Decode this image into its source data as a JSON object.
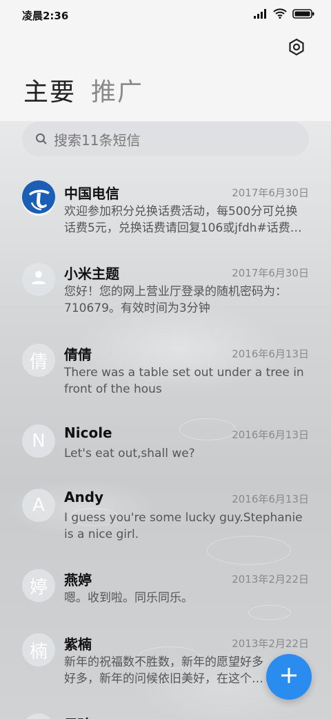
{
  "status_bar": {
    "time": "凌晨2:36"
  },
  "tabs": [
    {
      "label": "主要",
      "active": true
    },
    {
      "label": "推广",
      "active": false
    }
  ],
  "search": {
    "placeholder": "搜索11条短信"
  },
  "conversations": [
    {
      "name": "中国电信",
      "date": "2017年6月30日",
      "preview": "欢迎参加积分兑换话费活动，每500分可兑换话费5元，兑换话费请回复106或jfdh#话费…",
      "avatar_type": "logo",
      "avatar_text": ""
    },
    {
      "name": "小米主题",
      "date": "2017年6月30日",
      "preview": "您好！您的网上营业厅登录的随机密码为：710679。有效时间为3分钟",
      "avatar_type": "person",
      "avatar_text": ""
    },
    {
      "name": "倩倩",
      "date": "2016年6月13日",
      "preview": "There was a table set out under a tree in front of the hous",
      "avatar_type": "letter",
      "avatar_text": "倩"
    },
    {
      "name": "Nicole",
      "date": "2016年6月13日",
      "preview": "Let's eat out,shall we?",
      "avatar_type": "letter",
      "avatar_text": "N"
    },
    {
      "name": "Andy",
      "date": "2016年6月13日",
      "preview": "I guess you're some lucky guy.Stephanie is a nice girl.",
      "avatar_type": "letter",
      "avatar_text": "A"
    },
    {
      "name": "燕婷",
      "date": "2013年2月22日",
      "preview": "嗯。收到啦。同乐同乐。",
      "avatar_type": "letter",
      "avatar_text": "婷"
    },
    {
      "name": "紫楠",
      "date": "2013年2月22日",
      "preview": "新年的祝福数不胜数，新年的愿望好多好多，新年的问候依旧美好，在这个温馨的时刻",
      "avatar_type": "letter",
      "avatar_text": "楠"
    },
    {
      "name": "子玲",
      "date": "",
      "preview": "",
      "avatar_type": "letter",
      "avatar_text": ""
    }
  ],
  "colors": {
    "accent": "#2b8cf0",
    "telecom_blue": "#1a5eb5"
  },
  "icons": {
    "settings": "settings-icon",
    "search": "search-icon",
    "compose": "plus-icon"
  }
}
